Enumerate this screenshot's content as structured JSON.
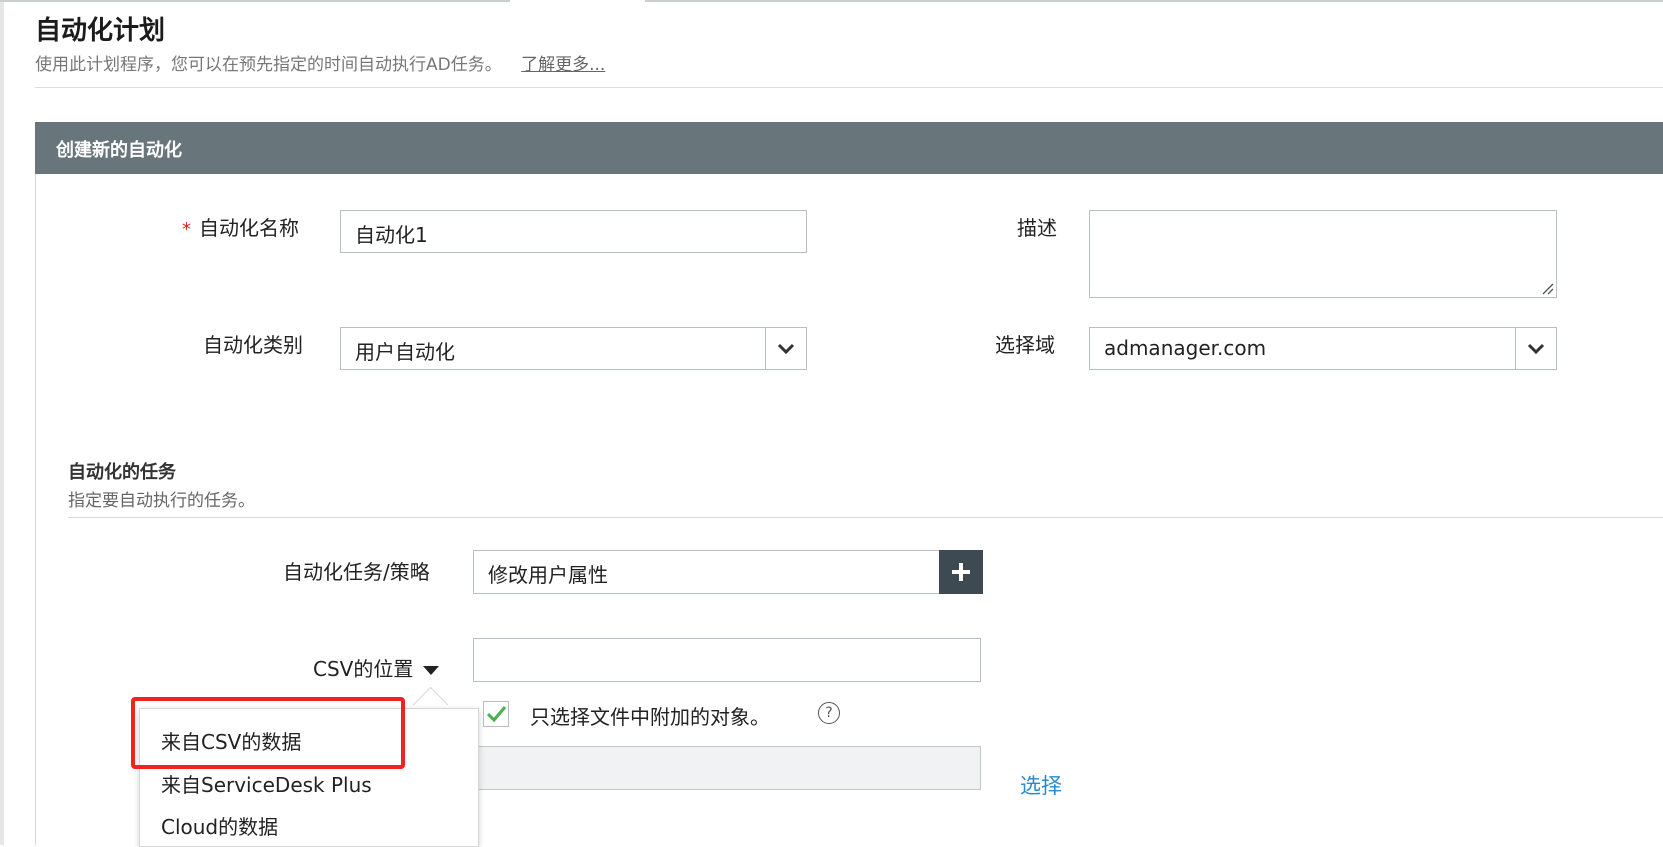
{
  "page": {
    "title": "自动化计划",
    "subtitle": "使用此计划程序，您可以在预先指定的时间自动执行AD任务。",
    "learn_more": "了解更多..."
  },
  "panel": {
    "title": "创建新的自动化"
  },
  "form": {
    "required_marker": "*",
    "name_label": "自动化名称",
    "name_value": "自动化1",
    "description_label": "描述",
    "description_value": "",
    "category_label": "自动化类别",
    "category_value": "用户自动化",
    "domain_label": "选择域",
    "domain_value": "admanager.com"
  },
  "tasks_section": {
    "title": "自动化的任务",
    "subtitle": "指定要自动执行的任务。",
    "task_label": "自动化任务/策略",
    "task_value": "修改用户属性",
    "csv_label": "CSV的位置",
    "csv_value": "",
    "checkbox_label": "只选择文件中附加的对象。",
    "checkbox_checked": true,
    "help_symbol": "?",
    "file_path_value": "",
    "select_link": "选择"
  },
  "csv_dropdown": {
    "options": [
      "来自CSV的数据",
      "来自ServiceDesk Plus",
      "Cloud的数据"
    ],
    "highlighted_index": 0
  },
  "colors": {
    "header_bg": "#68757b",
    "button_bg": "#3d4a52",
    "link": "#2c8ac9",
    "required": "#e02020",
    "highlight": "#f2231c",
    "check": "#4caf50"
  }
}
